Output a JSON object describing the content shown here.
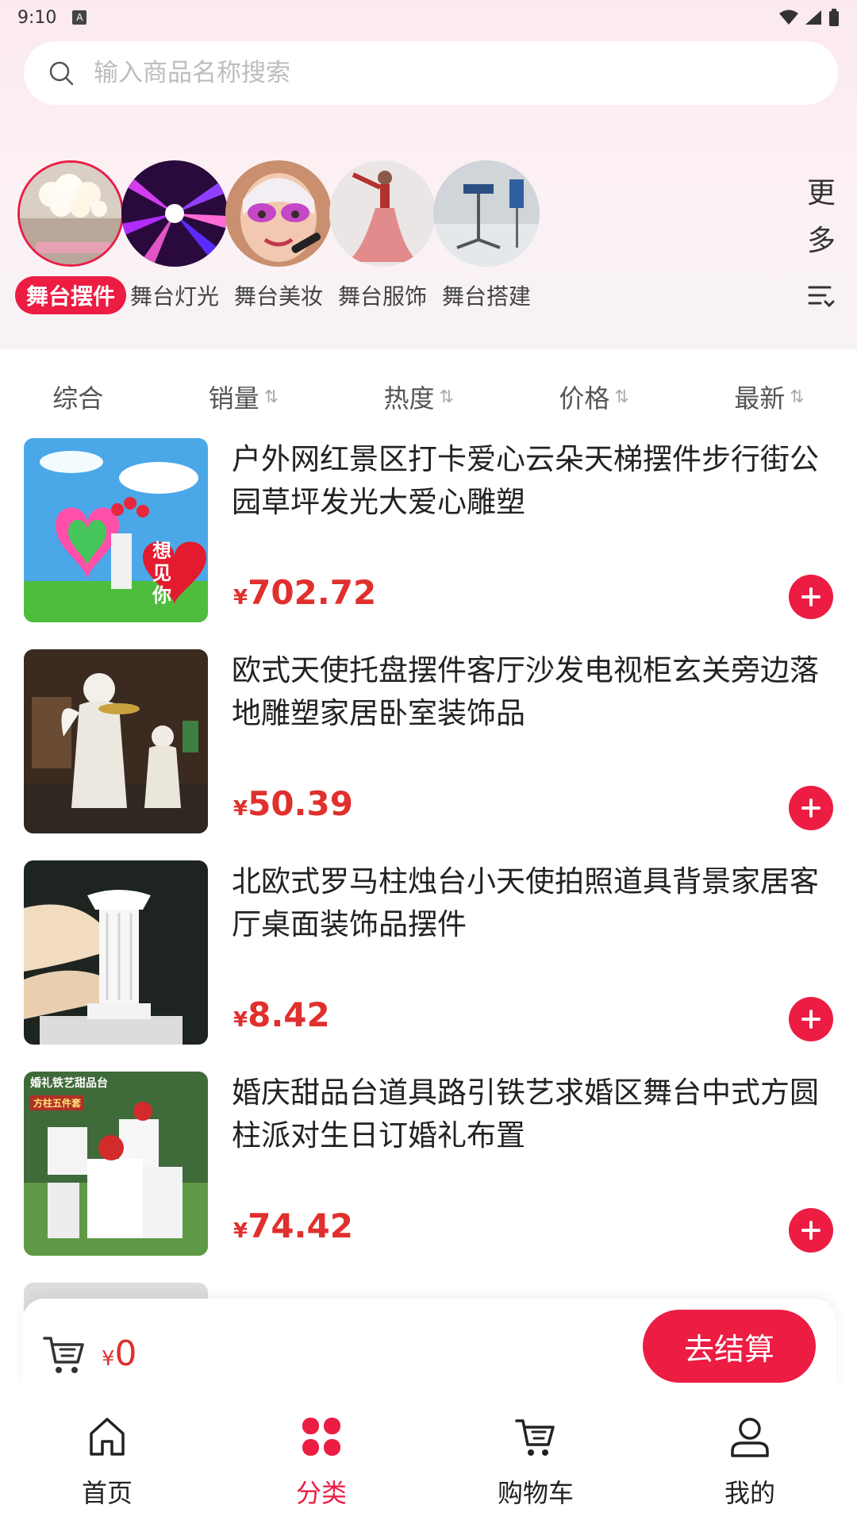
{
  "status_bar": {
    "time": "9:10",
    "a_badge": "A"
  },
  "search": {
    "placeholder": "输入商品名称搜索"
  },
  "categories": [
    {
      "label": "舞台摆件",
      "active": true
    },
    {
      "label": "舞台灯光",
      "active": false
    },
    {
      "label": "舞台美妆",
      "active": false
    },
    {
      "label": "舞台服饰",
      "active": false
    },
    {
      "label": "舞台搭建",
      "active": false
    }
  ],
  "more": {
    "line1": "更",
    "line2": "多"
  },
  "sort_tabs": [
    {
      "label": "综合",
      "arrow": ""
    },
    {
      "label": "销量",
      "arrow": "⇅"
    },
    {
      "label": "热度",
      "arrow": "⇅"
    },
    {
      "label": "价格",
      "arrow": "⇅"
    },
    {
      "label": "最新",
      "arrow": "⇅"
    }
  ],
  "products": [
    {
      "title": "户外网红景区打卡爱心云朵天梯摆件步行街公园草坪发光大爱心雕塑",
      "currency": "¥",
      "price": "702.72",
      "image_text": "想见你"
    },
    {
      "title": "欧式天使托盘摆件客厅沙发电视柜玄关旁边落地雕塑家居卧室装饰品",
      "currency": "¥",
      "price": "50.39"
    },
    {
      "title": "北欧式罗马柱烛台小天使拍照道具背景家居客厅桌面装饰品摆件",
      "currency": "¥",
      "price": "8.42"
    },
    {
      "title": "婚庆甜品台道具路引铁艺求婚区舞台中式方圆柱派对生日订婚礼布置",
      "currency": "¥",
      "price": "74.42",
      "image_text": "婚礼铁艺甜品台",
      "image_subtext": "方柱五件套"
    }
  ],
  "cart": {
    "currency": "¥",
    "total": "0",
    "checkout_label": "去结算"
  },
  "bottom_nav": [
    {
      "label": "首页",
      "icon": "home-icon",
      "active": false
    },
    {
      "label": "分类",
      "icon": "category-icon",
      "active": true
    },
    {
      "label": "购物车",
      "icon": "cart-icon",
      "active": false
    },
    {
      "label": "我的",
      "icon": "profile-icon",
      "active": false
    }
  ],
  "colors": {
    "accent": "#ec1c43",
    "price": "#e0302e"
  }
}
